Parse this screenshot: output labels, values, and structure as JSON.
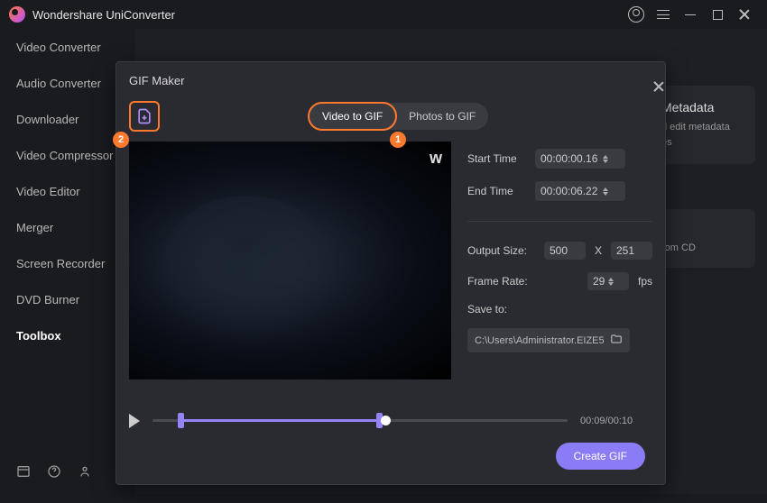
{
  "app": {
    "title": "Wondershare UniConverter"
  },
  "sidebar": {
    "items": [
      {
        "label": "Video Converter"
      },
      {
        "label": "Audio Converter"
      },
      {
        "label": "Downloader"
      },
      {
        "label": "Video Compressor"
      },
      {
        "label": "Video Editor"
      },
      {
        "label": "Merger"
      },
      {
        "label": "Screen Recorder"
      },
      {
        "label": "DVD Burner"
      },
      {
        "label": "Toolbox"
      }
    ],
    "active_index": 8
  },
  "bg": {
    "meta_title": "Metadata",
    "meta_sub1": "d edit metadata",
    "meta_sub2": "es",
    "cd_title": "r",
    "cd_sub": "rom CD"
  },
  "modal": {
    "title": "GIF Maker",
    "tabs": {
      "video": "Video to GIF",
      "photos": "Photos to GIF"
    },
    "steps": {
      "add": "2",
      "tab": "1"
    },
    "watermark": "w",
    "fields": {
      "start_label": "Start Time",
      "start_value": "00:00:00.16",
      "end_label": "End Time",
      "end_value": "00:00:06.22",
      "output_size_label": "Output Size:",
      "width": "500",
      "x": "X",
      "height": "251",
      "frame_rate_label": "Frame Rate:",
      "fps_value": "29",
      "fps_unit": "fps",
      "save_to_label": "Save to:",
      "save_path": "C:\\Users\\Administrator.EIZE5"
    },
    "player": {
      "time": "00:09/00:10"
    },
    "create_label": "Create GIF"
  }
}
